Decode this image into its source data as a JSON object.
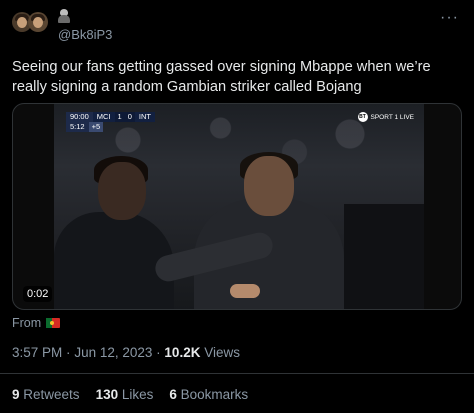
{
  "header": {
    "handle": "@Bk8iP3",
    "more_label": "···"
  },
  "tweet": {
    "text": "Seeing our fans getting gassed over signing Mbappe when we’re really signing a random Gambian striker called Bojang"
  },
  "video": {
    "duration": "0:02",
    "scorebug": {
      "clock": "90:00",
      "home": "MCI",
      "home_score": "1",
      "away_score": "0",
      "away": "INT",
      "added_time": "5:12",
      "plus": "+5"
    },
    "broadcaster": "SPORT 1 LIVE",
    "broadcaster_logo": "BT"
  },
  "from": {
    "label": "From",
    "flag": "portugal-flag-icon"
  },
  "meta": {
    "time": "3:57 PM",
    "separator": "·",
    "date": "Jun 12, 2023",
    "views_count": "10.2K",
    "views_label": "Views"
  },
  "stats": {
    "retweets_count": "9",
    "retweets_label": "Retweets",
    "likes_count": "130",
    "likes_label": "Likes",
    "bookmarks_count": "6",
    "bookmarks_label": "Bookmarks"
  },
  "colors": {
    "background": "#000000",
    "text": "#e7e9ea",
    "muted": "#8b98a5",
    "border": "#2f3336"
  }
}
